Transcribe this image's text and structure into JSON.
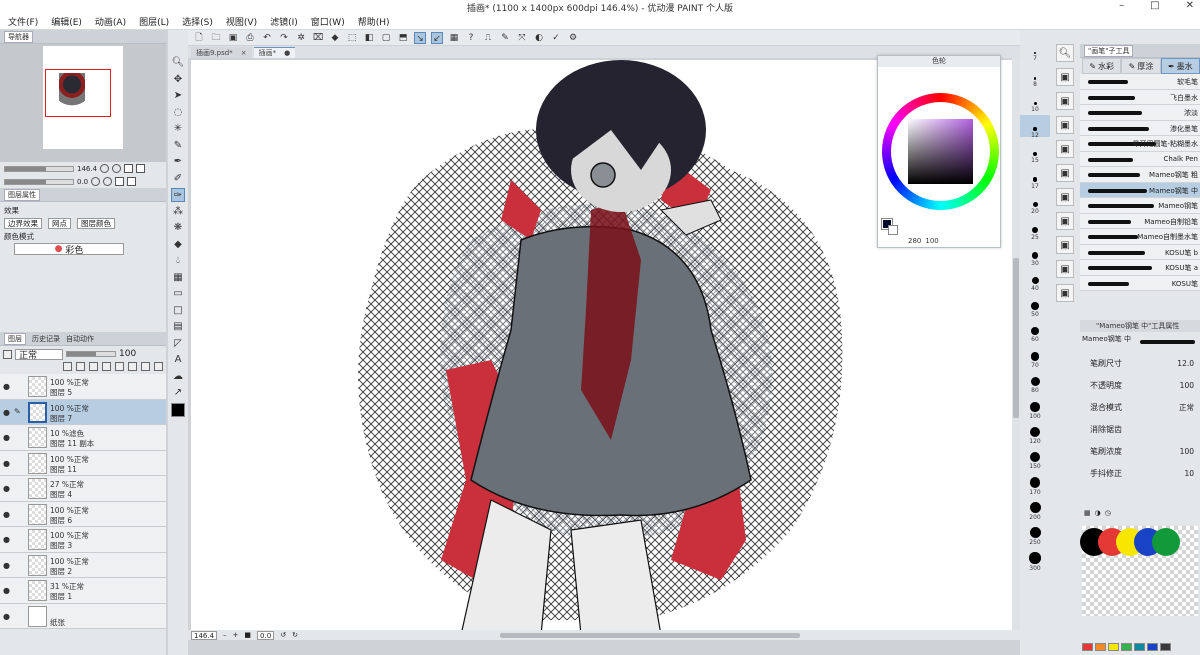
{
  "window": {
    "title": "插画* (1100 x 1400px 600dpi 146.4%) - 优动漫 PAINT 个人版"
  },
  "menu": [
    "文件(F)",
    "编辑(E)",
    "动画(A)",
    "图层(L)",
    "选择(S)",
    "视图(V)",
    "滤镜(I)",
    "窗口(W)",
    "帮助(H)"
  ],
  "navigator": {
    "tab_label": "导航器",
    "zoom_value": "146.4",
    "angle_value": "0.0"
  },
  "layer_property": {
    "tab_label": "图层属性",
    "effect_label": "效果",
    "effect_buttons": [
      "边界效果",
      "网点",
      "图层颜色"
    ],
    "color_mode_label": "颜色模式",
    "color_mode_value": "彩色"
  },
  "layers_panel": {
    "tabs": [
      "图层",
      "历史记录",
      "自动动作"
    ],
    "blend_mode": "正常",
    "opacity": "100",
    "layers": [
      {
        "line1": "100 %正常",
        "line2": "图层 5",
        "selected": false
      },
      {
        "line1": "100 %正常",
        "line2": "图层 7",
        "selected": true
      },
      {
        "line1": "10 %滤色",
        "line2": "图层 11 副本",
        "selected": false
      },
      {
        "line1": "100 %正常",
        "line2": "图层 11",
        "selected": false
      },
      {
        "line1": "27 %正常",
        "line2": "图层 4",
        "selected": false
      },
      {
        "line1": "100 %正常",
        "line2": "图层 6",
        "selected": false
      },
      {
        "line1": "100 %正常",
        "line2": "图层 3",
        "selected": false
      },
      {
        "line1": "100 %正常",
        "line2": "图层 2",
        "selected": false
      },
      {
        "line1": "31 %正常",
        "line2": "图层 1",
        "selected": false
      },
      {
        "line1": "",
        "line2": "纸张",
        "selected": false
      }
    ]
  },
  "doc_tabs": [
    "插画9.psd*",
    "插画*"
  ],
  "status": {
    "zoom": "146.4",
    "angle": "0.0"
  },
  "color_wheel": {
    "title": "色轮",
    "h_value": "280",
    "s_value": "100",
    "fg_color": "#0a0a2a",
    "bg_color": "#ffffff"
  },
  "brush_sizes": [
    "7",
    "8",
    "10",
    "12",
    "15",
    "17",
    "20",
    "25",
    "30",
    "40",
    "50",
    "60",
    "70",
    "80",
    "100",
    "120",
    "150",
    "170",
    "200",
    "250",
    "300"
  ],
  "brush_sizes_selected": "12",
  "subtool": {
    "header": "\"画笔\"子工具",
    "tabs": [
      "水彩",
      "厚涂",
      "墨水"
    ],
    "active_tab": "墨水",
    "brushes": [
      "软毛笔",
      "飞白墨水",
      "浓淡",
      "渗化墨笔",
      "晕开用圆笔-粘糊墨水",
      "Chalk Pen",
      "Mameo钢笔 粗",
      "Mameo钢笔 中",
      "Mameo钢笔",
      "Mameo自制铅笔",
      "Mameo自制墨水笔",
      "KOSU笔 b",
      "KOSU笔 a",
      "KOSU笔"
    ],
    "selected_brush": "Mameo钢笔 中"
  },
  "tool_property": {
    "header": "\"Mameo钢笔 中\"工具属性",
    "preview_name": "Mameo钢笔 中",
    "rows": [
      {
        "label": "笔刷尺寸",
        "value": "12.0"
      },
      {
        "label": "不透明度",
        "value": "100"
      },
      {
        "label": "混合模式",
        "value": "正常"
      },
      {
        "label": "消除锯齿",
        "value": ""
      },
      {
        "label": "笔刷浓度",
        "value": "100"
      },
      {
        "label": "手抖修正",
        "value": "10"
      }
    ]
  },
  "palette": {
    "circles": [
      "#000000",
      "#e53935",
      "#f7e600",
      "#1743c4",
      "#129a3a"
    ],
    "swatches": [
      "#e53935",
      "#f08a24",
      "#f7e600",
      "#35b34a",
      "#0e8aa0",
      "#1743c4",
      "#3a3a3a"
    ]
  },
  "icons": [
    "search-icon",
    "eye-icon",
    "pen-icon",
    "brush-icon",
    "eraser-icon",
    "fill-icon",
    "text-icon",
    "gear-icon"
  ]
}
